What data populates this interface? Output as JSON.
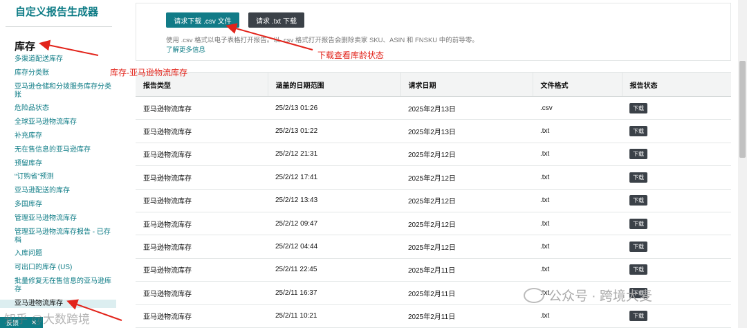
{
  "sidebar": {
    "app_title": "自定义报告生成器",
    "section_heading": "库存",
    "items": [
      {
        "label": "多渠道配送库存"
      },
      {
        "label": "库存分类账"
      },
      {
        "label": "亚马逊仓储和分拨服务库存分类账"
      },
      {
        "label": "危险品状态"
      },
      {
        "label": "全球亚马逊物流库存"
      },
      {
        "label": "补充库存"
      },
      {
        "label": "无在售信息的亚马逊库存"
      },
      {
        "label": "预留库存"
      },
      {
        "label": "“订购省”预测"
      },
      {
        "label": "亚马逊配送的库存"
      },
      {
        "label": "多国库存"
      },
      {
        "label": "管理亚马逊物流库存"
      },
      {
        "label": "管理亚马逊物流库存报告 - 已存档"
      },
      {
        "label": "入库问题"
      },
      {
        "label": "可出口的库存 (US)"
      },
      {
        "label": "批量修复无在售信息的亚马逊库存"
      },
      {
        "label": "亚马逊物流库存",
        "selected": true
      }
    ],
    "feedback_label": "反馈"
  },
  "request": {
    "csv_button": "请求下载 .csv 文件",
    "txt_button": "请求 .txt 下载",
    "description": "使用 .csv 格式以电子表格打开报告。以 .csv 格式打开报告会删除卖家 SKU、ASIN 和 FNSKU 中的前导零。",
    "learn_more": "了解更多信息"
  },
  "table": {
    "headers": [
      "报告类型",
      "涵盖的日期范围",
      "请求日期",
      "文件格式",
      "报告状态"
    ],
    "download_label": "下载",
    "rows": [
      {
        "type": "亚马逊物流库存",
        "range": "25/2/13 01:26",
        "requested": "2025年2月13日",
        "format": ".csv"
      },
      {
        "type": "亚马逊物流库存",
        "range": "25/2/13 01:22",
        "requested": "2025年2月13日",
        "format": ".txt"
      },
      {
        "type": "亚马逊物流库存",
        "range": "25/2/12 21:31",
        "requested": "2025年2月12日",
        "format": ".txt"
      },
      {
        "type": "亚马逊物流库存",
        "range": "25/2/12 17:41",
        "requested": "2025年2月12日",
        "format": ".txt"
      },
      {
        "type": "亚马逊物流库存",
        "range": "25/2/12 13:43",
        "requested": "2025年2月12日",
        "format": ".txt"
      },
      {
        "type": "亚马逊物流库存",
        "range": "25/2/12 09:47",
        "requested": "2025年2月12日",
        "format": ".txt"
      },
      {
        "type": "亚马逊物流库存",
        "range": "25/2/12 04:44",
        "requested": "2025年2月12日",
        "format": ".txt"
      },
      {
        "type": "亚马逊物流库存",
        "range": "25/2/11 22:45",
        "requested": "2025年2月11日",
        "format": ".txt"
      },
      {
        "type": "亚马逊物流库存",
        "range": "25/2/11 16:37",
        "requested": "2025年2月11日",
        "format": ".txt"
      },
      {
        "type": "亚马逊物流库存",
        "range": "25/2/11 10:21",
        "requested": "2025年2月11日",
        "format": ".txt"
      }
    ]
  },
  "annotations": {
    "inventory_path": "库存-亚马逊物流库存",
    "download_hint": "下载查看库龄状态",
    "color": "#e2231a"
  },
  "watermarks": {
    "right": "公众号 · 跨境大麦",
    "left": "知乎 @大数跨境"
  },
  "colors": {
    "accent": "#0e7c86",
    "button_dark": "#3b4148"
  }
}
